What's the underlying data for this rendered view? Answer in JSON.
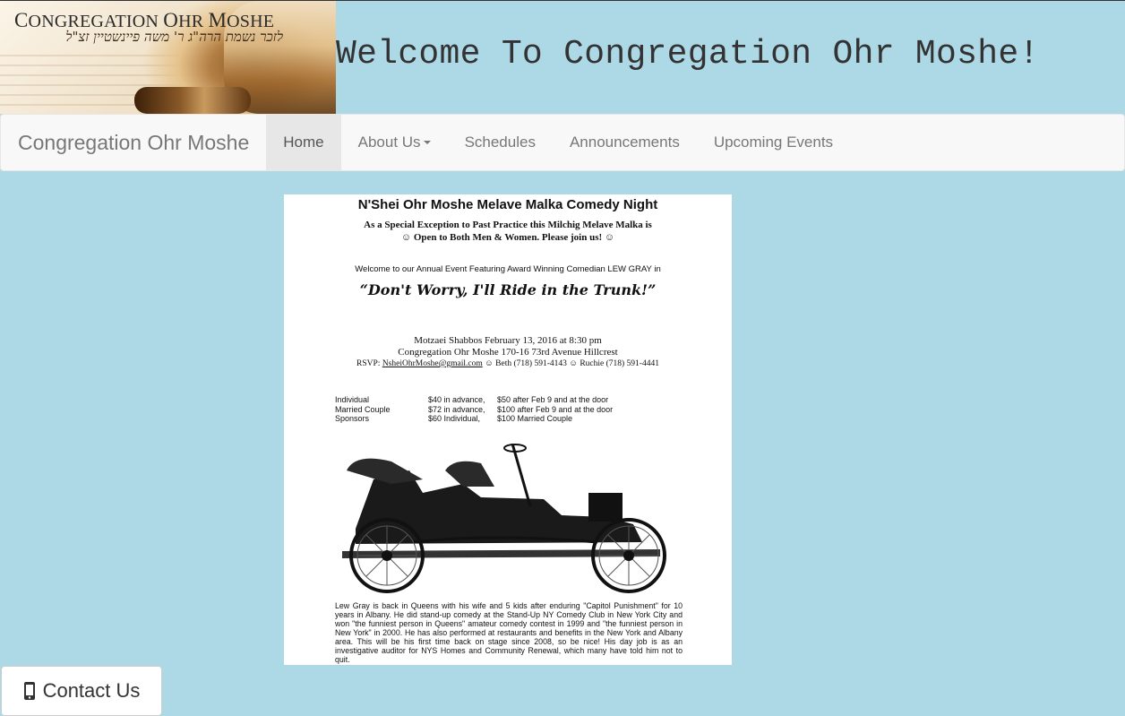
{
  "header": {
    "logo": {
      "title_first_letter": "C",
      "title_rest": "ONGREGATION",
      "title_second_first": "O",
      "title_second_rest": "HR",
      "title_third_first": "M",
      "title_third_rest": "OSHE",
      "hebrew_dedication": "לזכר נשמת הרה\"ג ר' משה פיינשטיין זצ\"ל"
    },
    "welcome": "Welcome To Congregation Ohr Moshe!"
  },
  "navbar": {
    "brand": "Congregation Ohr Moshe",
    "items": [
      {
        "label": "Home",
        "active": true
      },
      {
        "label": "About Us",
        "dropdown": true
      },
      {
        "label": "Schedules"
      },
      {
        "label": "Announcements"
      },
      {
        "label": "Upcoming Events"
      }
    ]
  },
  "flyer": {
    "title": "N'Shei Ohr Moshe Melave Malka Comedy Night",
    "subtitle_line1": "As a Special Exception to Past Practice this Milchig Melave Malka is",
    "subtitle_line2": "☺ Open to Both Men & Women.  Please join us! ☺",
    "welcome": "Welcome to our Annual Event Featuring Award Winning Comedian LEW GRAY in",
    "quote": "“Don't Worry, I'll Ride in the Trunk!”",
    "date": "Motzaei Shabbos February 13, 2016 at 8:30 pm",
    "venue": "Congregation Ohr Moshe 170-16 73rd Avenue Hillcrest",
    "rsvp_prefix": "RSVP: ",
    "rsvp_email": "NsheiOhrMoshe@gmail.com",
    "rsvp_rest": " ☺ Beth (718) 591-4143 ☺ Ruchie (718) 591-4441",
    "prices": [
      {
        "type": "Individual",
        "advance": "$40 in advance,",
        "door": "$50 after Feb 9 and at the door"
      },
      {
        "type": "Married Couple",
        "advance": "$72 in advance,",
        "door": "$100 after Feb 9 and at the door"
      },
      {
        "type": "Sponsors",
        "advance": "$60 Individual,",
        "door": "$100 Married Couple"
      }
    ],
    "bio": "Lew Gray is back in Queens with his wife and 5 kids after enduring \"Capitol Punishment\" for 10 years in Albany.  He did stand-up comedy at the Stand-Up NY Comedy Club in New York City and won \"the funniest person in Queens\" amateur comedy contest in 1999 and \"the funniest person in New York\" in 2000.  He has also performed at restaurants and benefits in the New York and Albany area.  This will be his first time back on stage since 2008, so be nice! His day job is as an investigative auditor for NYS Homes and Community Renewal, which many have told him not to quit."
  },
  "contact_button": {
    "label": "Contact Us",
    "icon": "mobile-phone-icon"
  }
}
